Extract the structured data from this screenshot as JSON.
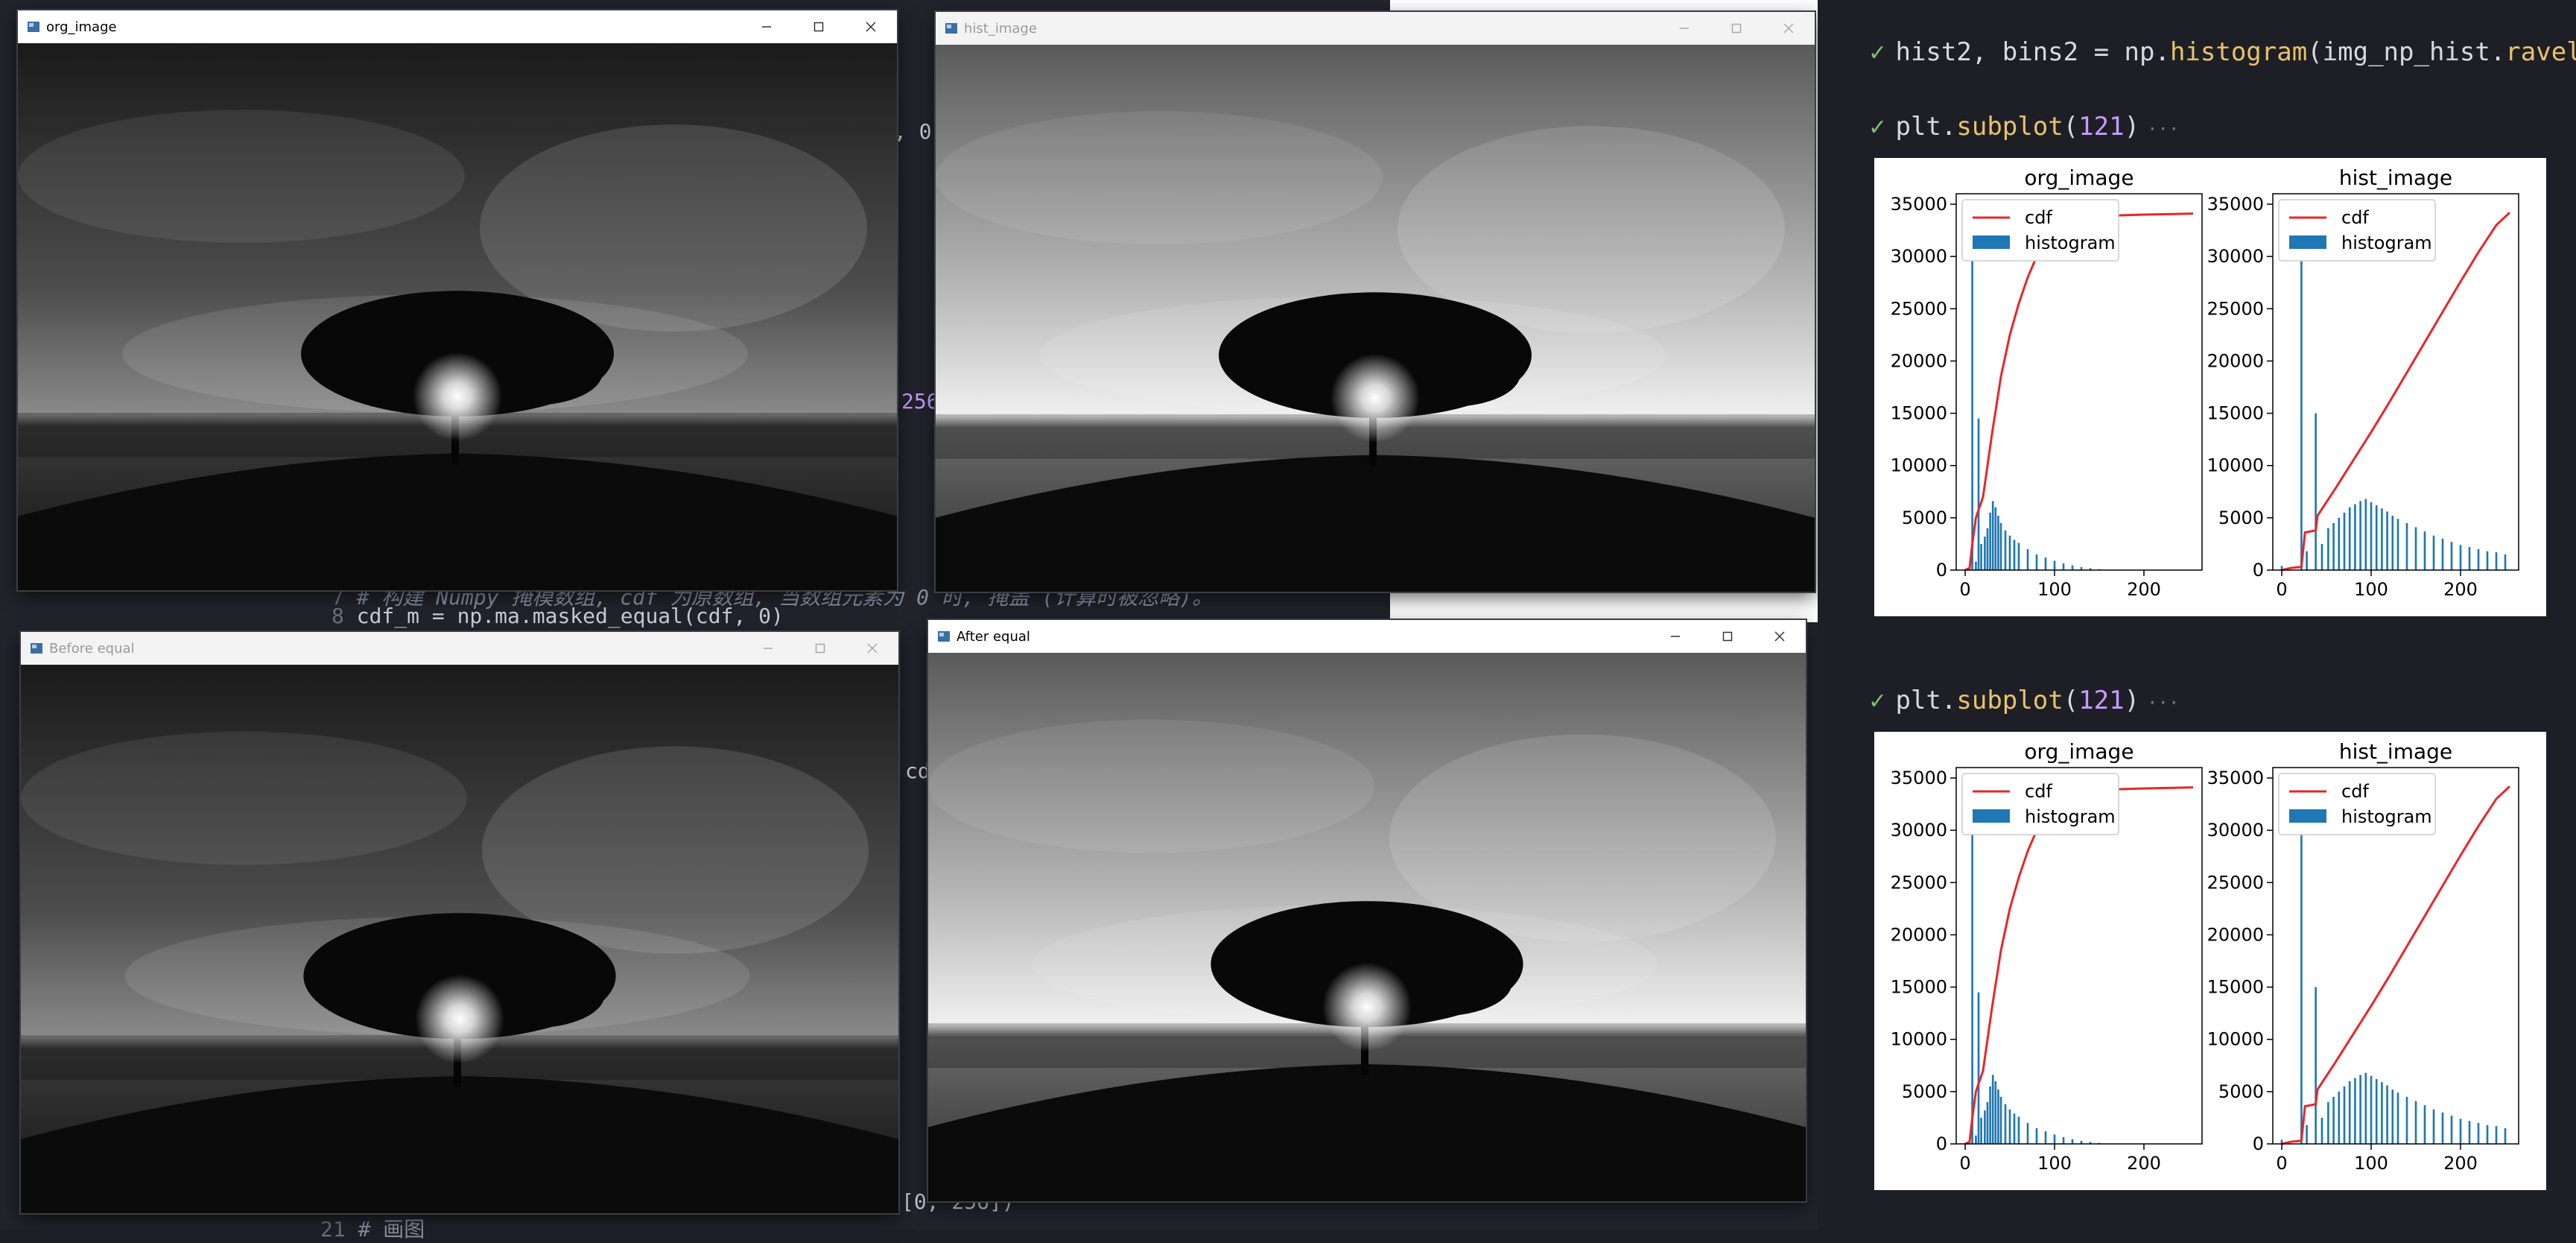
{
  "editor": {
    "lines": [
      {
        "text": "# 构建 Numpy 掩模数组, cdf 为原数组, 当数组元素为 0 时, 掩盖 (计算时被忽略)。",
        "num": "7"
      },
      {
        "text": "cdf_m = np.ma.masked_equal(cdf, 0)",
        "num": "8"
      },
      {
        "text": "[0, 256])",
        "num": ""
      },
      {
        "text": "# 画图",
        "num": "21"
      }
    ],
    "fragments": {
      "f1": ", 0",
      "f2": "256",
      "f3": "cd"
    }
  },
  "windows": [
    {
      "id": "org",
      "title": "org_image",
      "active": true,
      "variant": "orig"
    },
    {
      "id": "hist",
      "title": "hist_image",
      "active": false,
      "variant": "eq"
    },
    {
      "id": "before",
      "title": "Before equal",
      "active": false,
      "variant": "orig"
    },
    {
      "id": "after",
      "title": "After equal",
      "active": true,
      "variant": "eq"
    }
  ],
  "notebook": {
    "cells": [
      {
        "code": [
          "hist2, bins2 = np.",
          "histogram",
          "(img_np_hist.",
          "ravel",
          "(),"
        ]
      },
      {
        "code": [
          "plt.",
          "subplot",
          "(",
          "121",
          ")"
        ]
      },
      {
        "code": [
          "plt.",
          "subplot",
          "(",
          "121",
          ")"
        ]
      }
    ]
  },
  "chart_data": [
    {
      "type": "bar",
      "title": "org_image",
      "xlim": [
        -10,
        265
      ],
      "ylim": [
        0,
        36000
      ],
      "xticks": [
        0,
        100,
        200
      ],
      "yticks": [
        0,
        5000,
        10000,
        15000,
        20000,
        25000,
        30000,
        35000
      ],
      "legend": [
        "cdf",
        "histogram"
      ],
      "legend_position": "upper-left",
      "series": [
        {
          "name": "histogram",
          "kind": "bar",
          "color": "#1f77b4",
          "x": [
            5,
            8,
            12,
            15,
            18,
            22,
            25,
            28,
            31,
            34,
            37,
            40,
            45,
            50,
            55,
            60,
            70,
            80,
            90,
            100,
            110,
            120,
            130,
            140,
            150,
            160
          ],
          "values": [
            100,
            30000,
            800,
            14500,
            2500,
            3200,
            4000,
            5500,
            6600,
            6000,
            5200,
            4500,
            3800,
            3300,
            2900,
            2600,
            2000,
            1500,
            1200,
            900,
            650,
            450,
            300,
            180,
            90,
            40
          ]
        },
        {
          "name": "cdf",
          "kind": "line",
          "color": "#e8262a",
          "x": [
            0,
            5,
            8,
            12,
            20,
            30,
            40,
            50,
            60,
            70,
            80,
            90,
            100,
            120,
            140,
            160,
            200,
            255
          ],
          "values": [
            0,
            200,
            2500,
            5000,
            7000,
            13000,
            18500,
            22500,
            25500,
            28000,
            30000,
            31400,
            32400,
            33300,
            33700,
            33900,
            34000,
            34100
          ]
        }
      ]
    },
    {
      "type": "bar",
      "title": "hist_image",
      "xlim": [
        -10,
        265
      ],
      "ylim": [
        0,
        36000
      ],
      "xticks": [
        0,
        100,
        200
      ],
      "yticks": [
        0,
        5000,
        10000,
        15000,
        20000,
        25000,
        30000,
        35000
      ],
      "legend": [
        "cdf",
        "histogram"
      ],
      "legend_position": "upper-left",
      "series": [
        {
          "name": "histogram",
          "kind": "bar",
          "color": "#1f77b4",
          "x": [
            0,
            22,
            28,
            38,
            45,
            52,
            58,
            64,
            70,
            76,
            82,
            88,
            94,
            100,
            106,
            112,
            118,
            124,
            130,
            140,
            150,
            160,
            170,
            180,
            190,
            200,
            210,
            220,
            230,
            240,
            250
          ],
          "values": [
            400,
            30000,
            1800,
            15000,
            2500,
            4000,
            4500,
            5000,
            5500,
            6000,
            6300,
            6600,
            6800,
            6500,
            6200,
            5900,
            5600,
            5200,
            4900,
            4500,
            4100,
            3700,
            3300,
            3000,
            2700,
            2400,
            2200,
            2000,
            1800,
            1700,
            1500
          ]
        },
        {
          "name": "cdf",
          "kind": "line",
          "color": "#e8262a",
          "x": [
            0,
            10,
            22,
            26,
            38,
            40,
            60,
            80,
            100,
            120,
            140,
            160,
            180,
            200,
            220,
            240,
            255
          ],
          "values": [
            0,
            200,
            300,
            3600,
            3800,
            5200,
            7800,
            10500,
            13200,
            16000,
            18900,
            21800,
            24700,
            27600,
            30400,
            33000,
            34200
          ]
        }
      ]
    }
  ]
}
